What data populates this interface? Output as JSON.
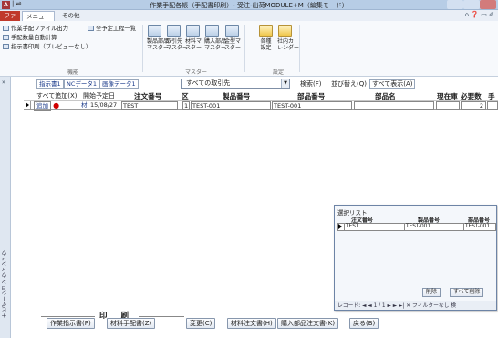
{
  "window": {
    "logo": "A",
    "quick_access": "| ⇌",
    "title": "作業手配各帳（手配書印刷）- 受注-出荷MODULE+M（編集モード）"
  },
  "ribbon_tabs": {
    "file": "ファイル",
    "menu": "メニュー",
    "other": "その他",
    "help": "⌂ ❓ ▭ ✐"
  },
  "ribbon": {
    "group1": {
      "items": [
        "作業手配ファイル出力",
        "手配数量自動計算",
        "指示書印刷（プレビューなし）"
      ],
      "side_item": "全予定工程一覧",
      "label": "機能"
    },
    "group2": {
      "buttons": [
        {
          "label": "製品部品\nマスター"
        },
        {
          "label": "取引先\nマスター"
        },
        {
          "label": "材料マ\nスター"
        },
        {
          "label": "購入部品\nマスター"
        },
        {
          "label": "金型マ\nスター"
        }
      ],
      "label": "マスター"
    },
    "group3": {
      "buttons": [
        {
          "label": "各種\n設定"
        },
        {
          "label": "社内カ\nレンダー"
        }
      ],
      "label": "設定"
    }
  },
  "navpane": {
    "chevron": "»",
    "label": "ナビゲーション ウィンドウ"
  },
  "form": {
    "toplinks": {
      "shijisho": "指示書1",
      "nc_data": "NCデータ1",
      "gazo_data": "画像データ1"
    },
    "client_filter": "すべての取引先",
    "search": "検索(F)",
    "sort": "並び替え(Q)",
    "show_all": "すべて表示(A)",
    "headers": {
      "add_all": "すべて追加(X)",
      "start_date": "開始予定日",
      "order_no": "注文番号",
      "kubun": "区",
      "product_no": "製品番号",
      "part_no": "部品番号",
      "part_name": "部品名",
      "stock": "現在庫",
      "required": "必要数",
      "extra": "手"
    },
    "row": {
      "add": "追加",
      "dot": "●",
      "zai": "材",
      "date": "15/08/27",
      "order_no": "TEST",
      "kubun": "1",
      "product_no": "TEST-001",
      "part_no": "TEST-001",
      "part_name": "",
      "stock": "",
      "required": "2"
    },
    "print_group": {
      "label": "印 刷",
      "work_order": "作業指示書(P)",
      "material_order": "材料手配書(Z)"
    },
    "buttons": {
      "change": "変更(C)",
      "material_po": "材料注文書(H)",
      "part_po": "購入部品注文書(K)",
      "back": "戻る(B)"
    }
  },
  "popup": {
    "title": "選択リスト",
    "headers": {
      "order_no": "注文番号",
      "product_no": "製品番号",
      "part_no": "部品番号"
    },
    "row": {
      "order_no": "TEST",
      "product_no": "TEST-001",
      "part_no": "TEST-001"
    },
    "delete": "削除",
    "delete_all": "すべて削除",
    "record_nav": "レコード: ◄ ◄ 1 / 1 ► ► ►|  ✕ フィルターなし  検"
  }
}
